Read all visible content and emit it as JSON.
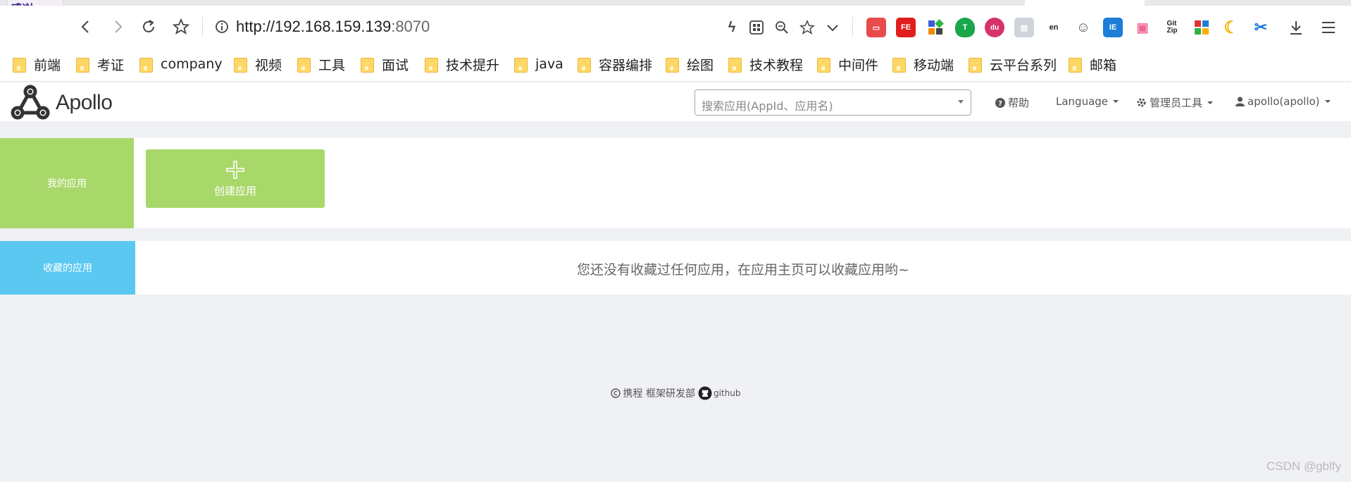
{
  "browser": {
    "url_host": "http://192.168.159.139",
    "url_port": ":8070",
    "bookmarks": [
      "前端",
      "考证",
      "company",
      "视频",
      "工具",
      "面试",
      "技术提升",
      "java",
      "容器编排",
      "绘图",
      "技术教程",
      "中间件",
      "移动端",
      "云平台系列",
      "邮箱"
    ],
    "extensions": [
      "lightning-icon",
      "qr-icon",
      "zoom-icon",
      "star-icon",
      "chevron-down-icon",
      "toolbox-icon",
      "fe-icon",
      "apps-icon",
      "tampermonkey-icon",
      "du-icon",
      "reader-icon",
      "translate-icon",
      "palette-icon",
      "jsonview-icon",
      "bilibili-icon",
      "gitzip-icon",
      "grid-icon",
      "moon-icon",
      "scissors-icon",
      "download-icon",
      "menu-icon"
    ]
  },
  "app": {
    "logo_text": "Apollo",
    "search_placeholder": "搜索应用(AppId、应用名)",
    "nav_help": "帮助",
    "nav_language": "Language",
    "nav_admin": "管理员工具",
    "nav_user": "apollo(apollo)"
  },
  "my_apps": {
    "label": "我的应用",
    "create_label": "创建应用"
  },
  "favorites": {
    "label": "收藏的应用",
    "empty_message": "您还没有收藏过任何应用，在应用主页可以收藏应用哟~"
  },
  "footer": {
    "copyright": "携程 框架研发部",
    "github": "github"
  },
  "watermark": "CSDN @gblfy",
  "colors": {
    "my_apps_side": "#a8d86a",
    "favorites_side": "#5bc8f2",
    "create_btn": "#a8d86a"
  }
}
